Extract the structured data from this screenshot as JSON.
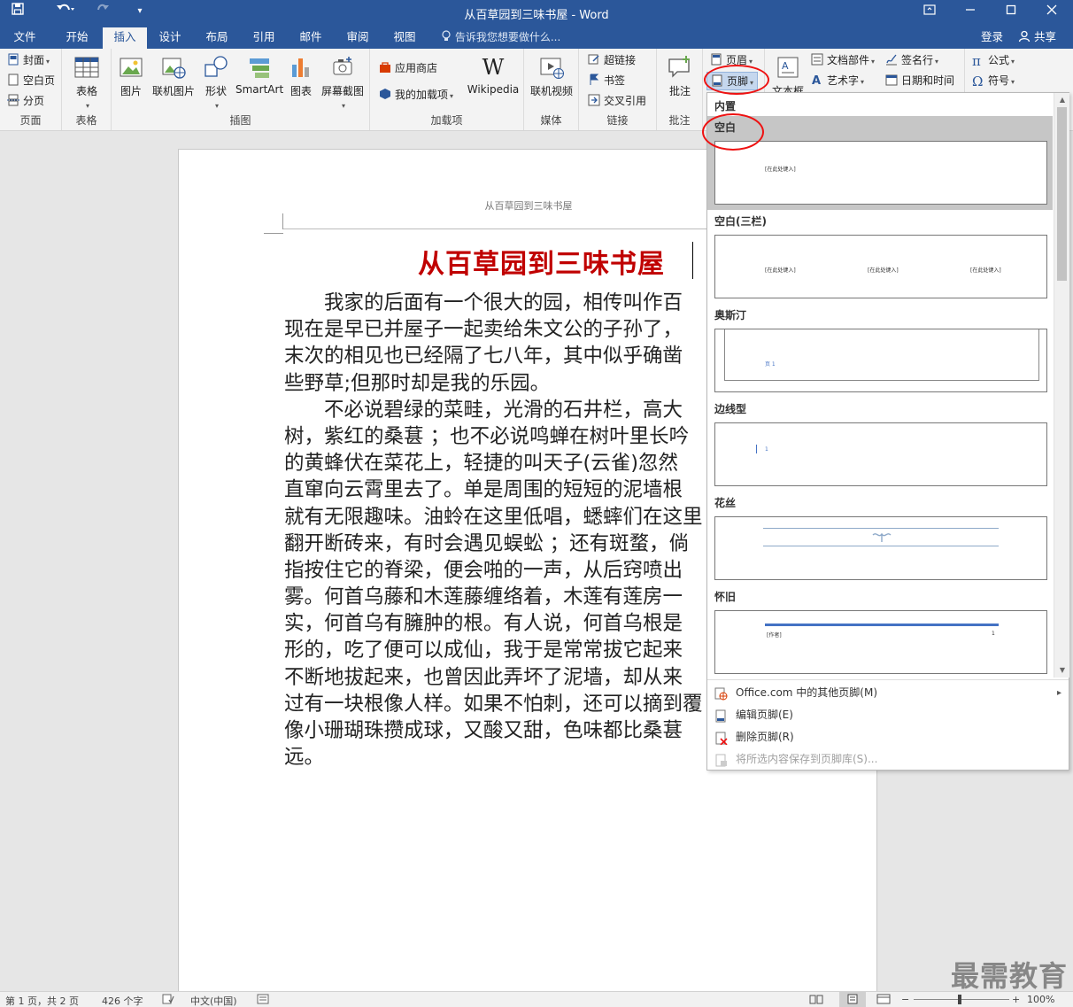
{
  "window": {
    "title": "从百草园到三味书屋 - Word"
  },
  "tabs": [
    {
      "label": "文件"
    },
    {
      "label": "开始"
    },
    {
      "label": "插入"
    },
    {
      "label": "设计"
    },
    {
      "label": "布局"
    },
    {
      "label": "引用"
    },
    {
      "label": "邮件"
    },
    {
      "label": "审阅"
    },
    {
      "label": "视图"
    }
  ],
  "tell_me": "告诉我您想要做什么...",
  "signin": "登录",
  "share": "共享",
  "ribbon": {
    "pages": {
      "label": "页面",
      "cover": "封面",
      "blank": "空白页",
      "break": "分页"
    },
    "tables": {
      "label": "表格",
      "table": "表格"
    },
    "illustrations": {
      "label": "插图",
      "picture": "图片",
      "online_picture": "联机图片",
      "shapes": "形状",
      "smartart": "SmartArt",
      "chart": "图表",
      "screenshot": "屏幕截图"
    },
    "addins": {
      "label": "加载项",
      "store": "应用商店",
      "my_addins": "我的加载项",
      "wikipedia": "Wikipedia"
    },
    "media": {
      "label": "媒体",
      "online_video": "联机视频"
    },
    "links": {
      "label": "链接",
      "hyperlink": "超链接",
      "bookmark": "书签",
      "crossref": "交叉引用"
    },
    "comments": {
      "label": "批注",
      "comment": "批注"
    },
    "hf": {
      "header": "页眉",
      "footer": "页脚"
    },
    "text": {
      "textbox": "文本框",
      "quickparts": "文档部件",
      "wordart": "艺术字",
      "signature": "签名行",
      "datetime": "日期和时间"
    },
    "symbols": {
      "equation": "公式",
      "symbol": "符号"
    }
  },
  "document": {
    "header_text": "从百草园到三味书屋",
    "title": "从百草园到三味书屋",
    "lines": [
      "　　我家的后面有一个很大的园，相传叫作百",
      "现在是早已并屋子一起卖给朱文公的子孙了，",
      "末次的相见也已经隔了七八年，其中似乎确凿",
      "些野草;但那时却是我的乐园。",
      "　　不必说碧绿的菜畦，光滑的石井栏，高大",
      "树，紫红的桑葚 ；也不必说鸣蝉在树叶里长吟",
      "的黄蜂伏在菜花上，轻捷的叫天子(云雀)忽然",
      "直窜向云霄里去了。单是周围的短短的泥墙根",
      "就有无限趣味。油蛉在这里低唱，蟋蟀们在这里",
      "翻开断砖来，有时会遇见蜈蚣 ；还有斑蝥，倘",
      "指按住它的脊梁，便会啪的一声，从后窍喷出",
      "雾。何首乌藤和木莲藤缠络着，木莲有莲房一",
      "实，何首乌有臃肿的根。有人说，何首乌根是",
      "形的，吃了便可以成仙，我于是常常拔它起来",
      "不断地拔起来，也曾因此弄坏了泥墙，却从来",
      "过有一块根像人样。如果不怕刺，还可以摘到覆",
      "像小珊瑚珠攒成球，又酸又甜，色味都比桑葚",
      "远。"
    ]
  },
  "footer_dropdown": {
    "category": "内置",
    "items": [
      {
        "name": "空白",
        "placeholders": [
          "[在此处键入]"
        ]
      },
      {
        "name": "空白(三栏)",
        "placeholders": [
          "[在此处键入]",
          "[在此处键入]",
          "[在此处键入]"
        ]
      },
      {
        "name": "奥斯汀",
        "placeholders": [
          "页 1"
        ]
      },
      {
        "name": "边线型",
        "placeholders": [
          "1"
        ]
      },
      {
        "name": "花丝",
        "placeholders": []
      },
      {
        "name": "怀旧",
        "placeholders": [
          "[作者]",
          "1"
        ]
      }
    ],
    "menu": [
      {
        "label": "Office.com 中的其他页脚(M)",
        "enabled": true
      },
      {
        "label": "编辑页脚(E)",
        "enabled": true
      },
      {
        "label": "删除页脚(R)",
        "enabled": true
      },
      {
        "label": "将所选内容保存到页脚库(S)...",
        "enabled": false
      }
    ]
  },
  "status": {
    "page": "第 1 页，共 2 页",
    "words": "426 个字",
    "language": "中文(中国)",
    "zoom": "100%"
  },
  "watermark": "最需教育",
  "colors": {
    "accent": "#2b579a",
    "title_red": "#c00000",
    "highlight_circle": "#e11111"
  }
}
